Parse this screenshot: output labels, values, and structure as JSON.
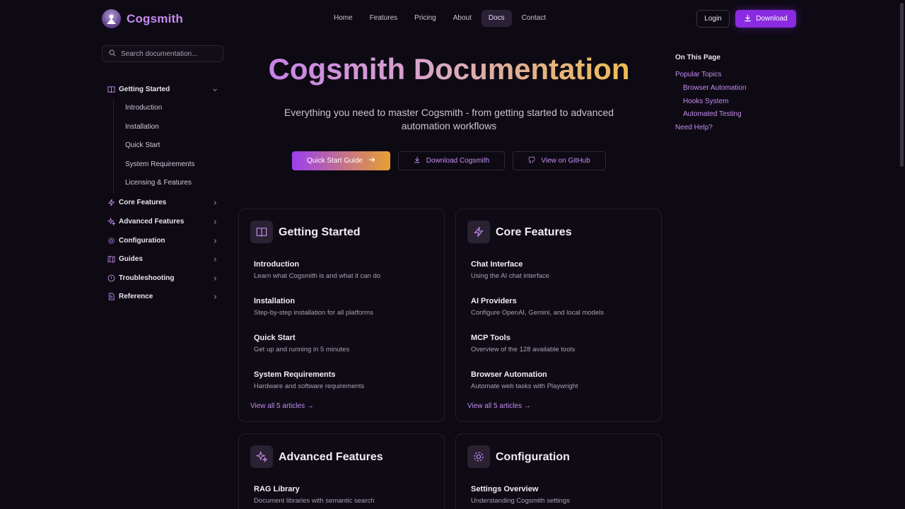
{
  "brand": {
    "name": "Cogsmith",
    "accent": "#c58df0",
    "button": "#8a2be2"
  },
  "nav": {
    "items": [
      "Home",
      "Features",
      "Pricing",
      "About",
      "Docs",
      "Contact"
    ],
    "active": "Docs",
    "login": "Login",
    "download": "Download"
  },
  "sidebar": {
    "search_placeholder": "Search documentation...",
    "groups": [
      {
        "label": "Getting Started",
        "icon": "book-icon",
        "expanded": true,
        "items": [
          "Introduction",
          "Installation",
          "Quick Start",
          "System Requirements",
          "Licensing & Features"
        ]
      },
      {
        "label": "Core Features",
        "icon": "lightning-icon"
      },
      {
        "label": "Advanced Features",
        "icon": "sparkles-icon"
      },
      {
        "label": "Configuration",
        "icon": "gear-icon"
      },
      {
        "label": "Guides",
        "icon": "map-icon"
      },
      {
        "label": "Troubleshooting",
        "icon": "alert-circle-icon"
      },
      {
        "label": "Reference",
        "icon": "file-text-icon"
      }
    ]
  },
  "hero": {
    "title": "Cogsmith Documentation",
    "subtitle": "Everything you need to master Cogsmith - from getting started to advanced automation workflows",
    "cta_primary": "Quick Start Guide",
    "cta_download": "Download Cogsmith",
    "cta_github": "View on GitHub"
  },
  "cards": [
    {
      "title": "Getting Started",
      "icon": "book-icon",
      "items": [
        {
          "title": "Introduction",
          "desc": "Learn what Cogsmith is and what it can do"
        },
        {
          "title": "Installation",
          "desc": "Step-by-step installation for all platforms"
        },
        {
          "title": "Quick Start",
          "desc": "Get up and running in 5 minutes"
        },
        {
          "title": "System Requirements",
          "desc": "Hardware and software requirements"
        }
      ],
      "link": "View all 5 articles →"
    },
    {
      "title": "Core Features",
      "icon": "lightning-icon",
      "items": [
        {
          "title": "Chat Interface",
          "desc": "Using the AI chat interface"
        },
        {
          "title": "AI Providers",
          "desc": "Configure OpenAI, Gemini, and local models"
        },
        {
          "title": "MCP Tools",
          "desc": "Overview of the 128 available tools"
        },
        {
          "title": "Browser Automation",
          "desc": "Automate web tasks with Playwright"
        }
      ],
      "link": "View all 5 articles →"
    },
    {
      "title": "Advanced Features",
      "icon": "sparkles-icon",
      "items": [
        {
          "title": "RAG Library",
          "desc": "Document libraries with semantic search"
        }
      ]
    },
    {
      "title": "Configuration",
      "icon": "gear-icon",
      "items": [
        {
          "title": "Settings Overview",
          "desc": "Understanding Cogsmith settings"
        }
      ]
    }
  ],
  "toc": {
    "heading": "On This Page",
    "items": [
      "Popular Topics",
      "Browser Automation",
      "Hooks System",
      "Automated Testing",
      "Need Help?"
    ]
  }
}
